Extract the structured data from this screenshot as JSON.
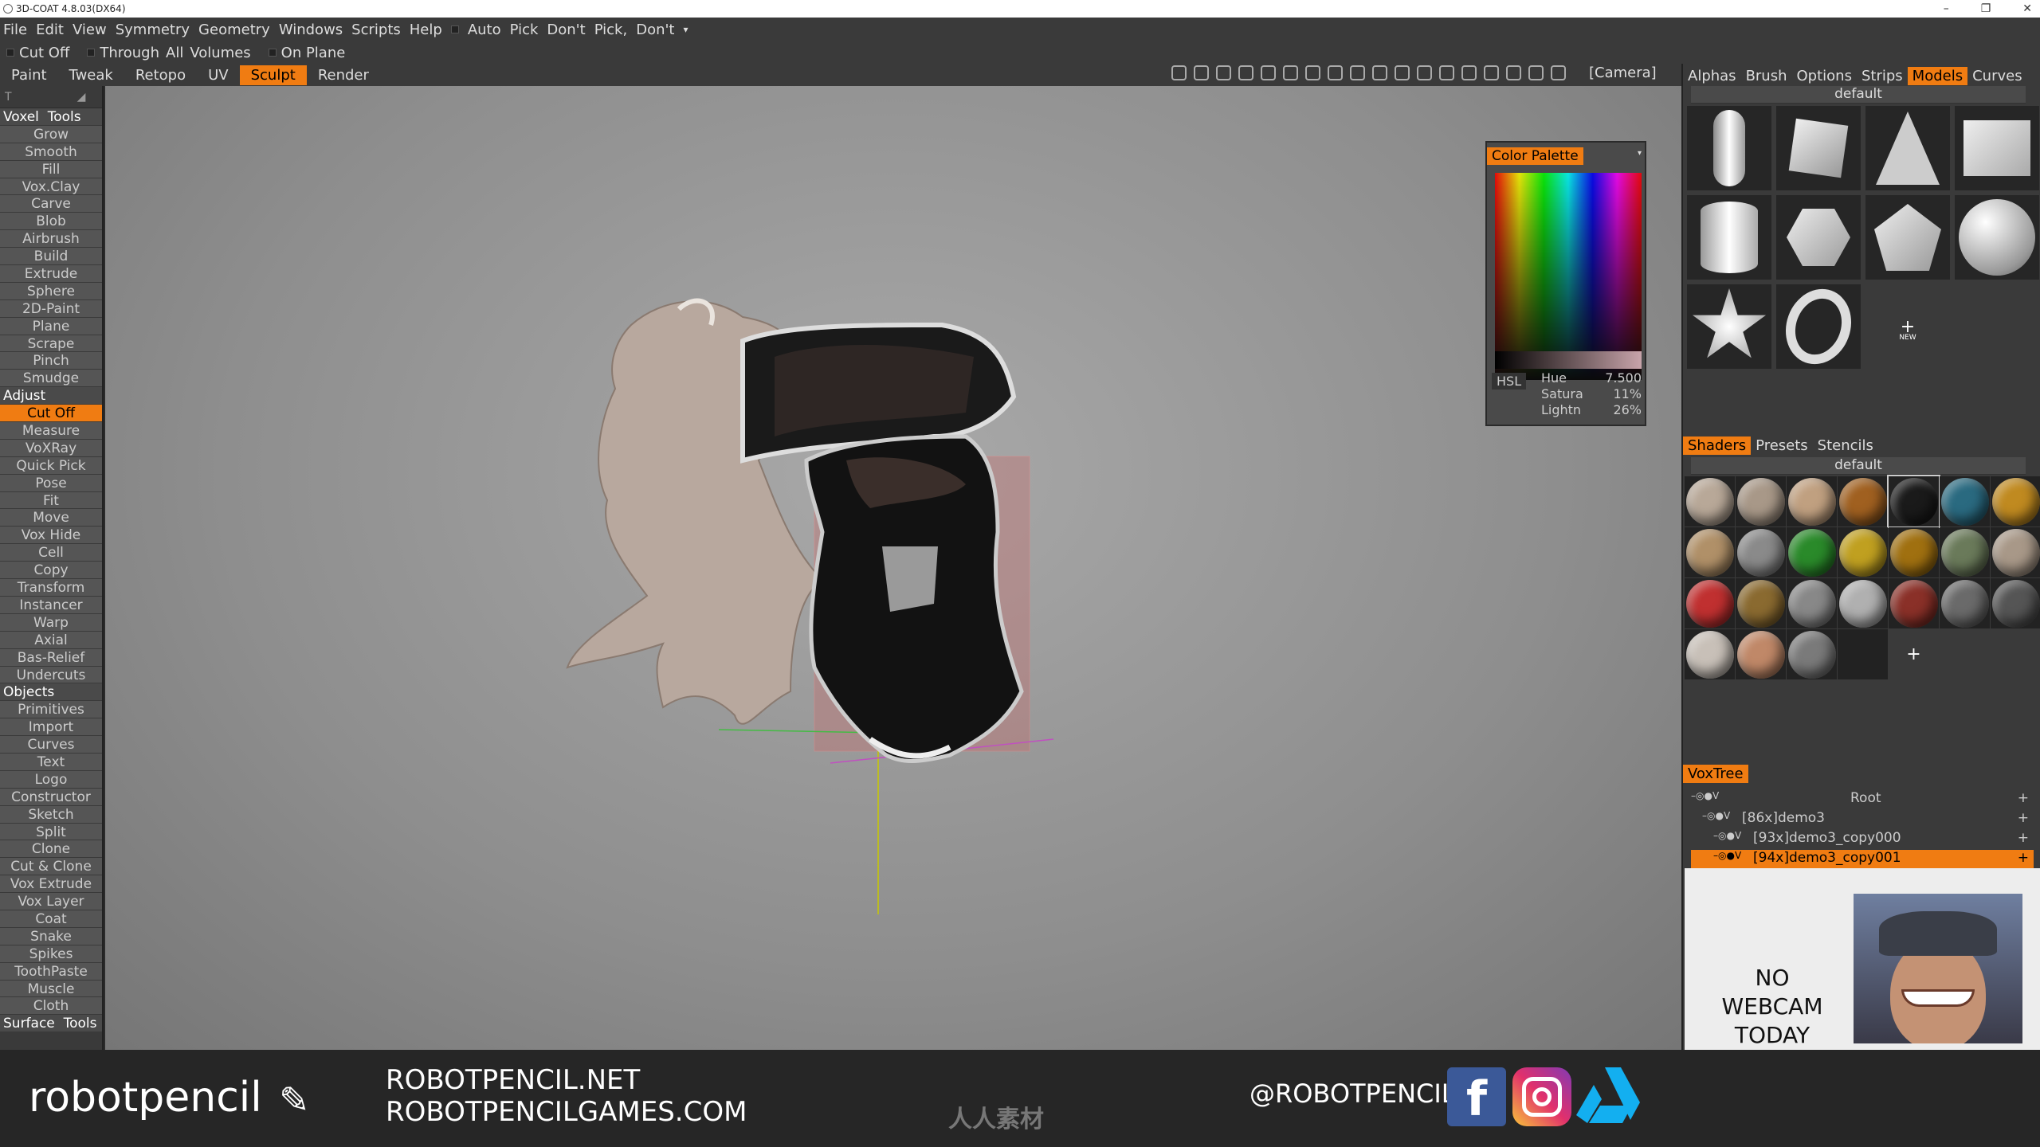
{
  "titlebar": {
    "title": "3D-COAT 4.8.03(DX64)",
    "min": "–",
    "max": "❐",
    "close": "✕"
  },
  "menu": [
    "File",
    "Edit",
    "View",
    "Symmetry",
    "Geometry",
    "Windows",
    "Scripts",
    "Help",
    "Auto",
    "Pick",
    "Don't",
    "Pick,",
    "Don't"
  ],
  "toolbar": {
    "cut_off": "Cut  Off",
    "through": "Through",
    "all": "All",
    "volumes": "Volumes",
    "on_plane": "On  Plane"
  },
  "rooms": [
    {
      "label": "Paint",
      "active": false
    },
    {
      "label": "Tweak",
      "active": false
    },
    {
      "label": "Retopo",
      "active": false
    },
    {
      "label": "UV",
      "active": false
    },
    {
      "label": "Sculpt",
      "active": true
    },
    {
      "label": "Render",
      "active": false
    }
  ],
  "viewport": {
    "camera": "[Camera]"
  },
  "left_panel": {
    "items": [
      {
        "label": "Voxel  Tools",
        "type": "cat"
      },
      {
        "label": "Grow"
      },
      {
        "label": "Smooth"
      },
      {
        "label": "Fill"
      },
      {
        "label": "Vox.Clay"
      },
      {
        "label": "Carve"
      },
      {
        "label": "Blob"
      },
      {
        "label": "Airbrush"
      },
      {
        "label": "Build"
      },
      {
        "label": "Extrude"
      },
      {
        "label": "Sphere"
      },
      {
        "label": "2D-Paint"
      },
      {
        "label": "Plane"
      },
      {
        "label": "Scrape"
      },
      {
        "label": "Pinch"
      },
      {
        "label": "Smudge"
      },
      {
        "label": "Adjust",
        "type": "cat"
      },
      {
        "label": "Cut  Off",
        "active": true
      },
      {
        "label": "Measure"
      },
      {
        "label": "VoXRay"
      },
      {
        "label": "Quick  Pick"
      },
      {
        "label": "Pose"
      },
      {
        "label": "Fit"
      },
      {
        "label": "Move"
      },
      {
        "label": "Vox  Hide"
      },
      {
        "label": "Cell"
      },
      {
        "label": "Copy"
      },
      {
        "label": "Transform"
      },
      {
        "label": "Instancer"
      },
      {
        "label": "Warp"
      },
      {
        "label": "Axial"
      },
      {
        "label": "Bas-Relief"
      },
      {
        "label": "Undercuts"
      },
      {
        "label": "Objects",
        "type": "cat"
      },
      {
        "label": "Primitives"
      },
      {
        "label": "Import"
      },
      {
        "label": "Curves"
      },
      {
        "label": "Text"
      },
      {
        "label": "Logo"
      },
      {
        "label": "Constructor"
      },
      {
        "label": "Sketch"
      },
      {
        "label": "Split"
      },
      {
        "label": "Clone"
      },
      {
        "label": "Cut  &  Clone"
      },
      {
        "label": "Vox  Extrude"
      },
      {
        "label": "Vox  Layer"
      },
      {
        "label": "Coat"
      },
      {
        "label": "Snake"
      },
      {
        "label": "Spikes"
      },
      {
        "label": "ToothPaste"
      },
      {
        "label": "Muscle"
      },
      {
        "label": "Cloth"
      },
      {
        "label": "Surface  Tools",
        "type": "cat"
      }
    ]
  },
  "color_palette": {
    "title": "Color  Palette",
    "mode": "HSL",
    "hue_label": "Hue",
    "hue": "7.500",
    "sat_label": "Satura",
    "sat": "11%",
    "light_label": "Lightn",
    "light": "26%"
  },
  "right_panel": {
    "top_tabs": [
      {
        "label": "Alphas",
        "active": false
      },
      {
        "label": "Brush",
        "active": false
      },
      {
        "label": "Options",
        "active": false
      },
      {
        "label": "Strips",
        "active": false
      },
      {
        "label": "Models",
        "active": true
      },
      {
        "label": "Curves",
        "active": false
      }
    ],
    "models_preset": "default",
    "models": [
      "capsule",
      "cube",
      "cone",
      "box",
      "cylinder",
      "hex",
      "pentagon",
      "sphere",
      "star",
      "torus",
      "new"
    ],
    "new_label": "NEW",
    "shader_tabs": [
      {
        "label": "Shaders",
        "active": true
      },
      {
        "label": "Presets",
        "active": false
      },
      {
        "label": "Stencils",
        "active": false
      }
    ],
    "shaders_preset": "default",
    "shader_colors": [
      "#b8a898",
      "#a89888",
      "#c0a080",
      "#a06020",
      "#1a1a1a",
      "#2a6a80",
      "#c08a20",
      "#b09068",
      "#8a8a8a",
      "#2a8a2a",
      "#c0a020",
      "#a07010",
      "#6a7a5a",
      "#a89888",
      "#c03030",
      "#8a6a30",
      "#888888",
      "#b0b0b0",
      "#8a3028",
      "#6a6a6a",
      "#555555",
      "#c8c0b8",
      "#c08868",
      "#7a7a7a",
      "#111111"
    ],
    "voxtree_title": "VoxTree",
    "voxtree": [
      {
        "label": "Root",
        "indent": 0,
        "selected": false
      },
      {
        "label": "[86x]demo3",
        "indent": 1,
        "selected": false
      },
      {
        "label": "[93x]demo3_copy000",
        "indent": 2,
        "selected": false
      },
      {
        "label": "[94x]demo3_copy001",
        "indent": 2,
        "selected": true
      }
    ]
  },
  "webcam": {
    "line1": "NO",
    "line2": "WEBCAM",
    "line3": "TODAY"
  },
  "footer": {
    "brand": "robotpencil",
    "url1": "ROBOTPENCIL.NET",
    "url2": "ROBOTPENCILGAMES.COM",
    "handle": "@ROBOTPENCIL",
    "watermark": "人人素材"
  },
  "colors": {
    "accent": "#f07c12",
    "panel": "#3a3a3a",
    "dark": "#262626"
  }
}
